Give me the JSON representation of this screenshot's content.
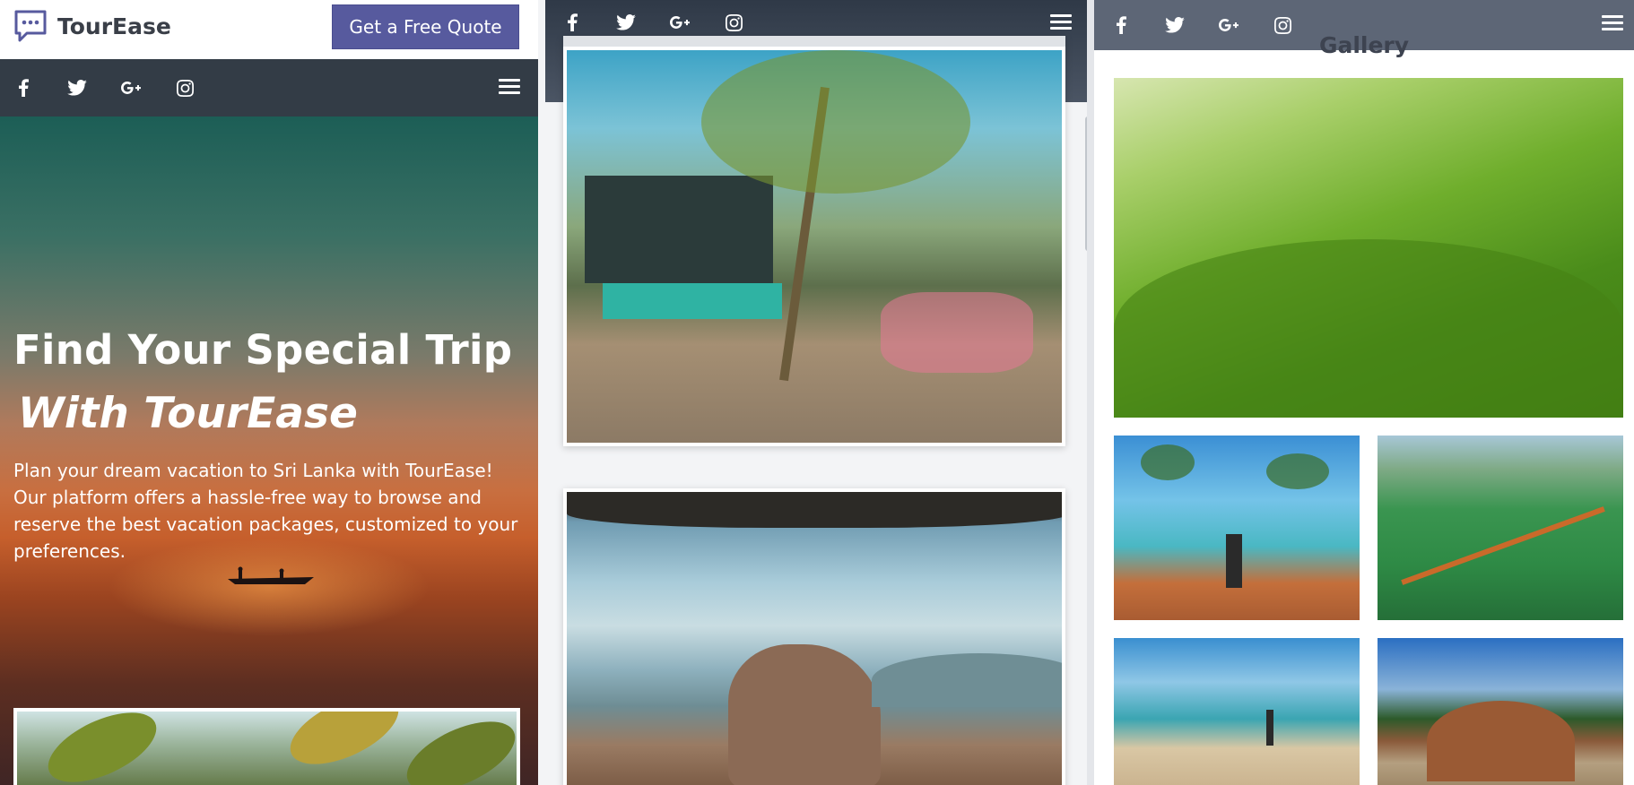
{
  "panel_home": {
    "brand": "TourEase",
    "quote_button": "Get a Free Quote",
    "hero": {
      "title_line1": "Find Your Special Trip",
      "title_line2": "With TourEase",
      "description": "Plan your dream vacation to Sri Lanka with TourEase! Our platform offers a hassle-free way to browse and reserve the best vacation packages, customized to your preferences."
    }
  },
  "social_icons": [
    "facebook-icon",
    "twitter-icon",
    "google-plus-icon",
    "instagram-icon"
  ],
  "panel_gallery": {
    "title": "Gallery"
  },
  "colors": {
    "accent": "#575a9e",
    "navbar": "#333c46",
    "navbar_gallery": "#5d6676"
  }
}
